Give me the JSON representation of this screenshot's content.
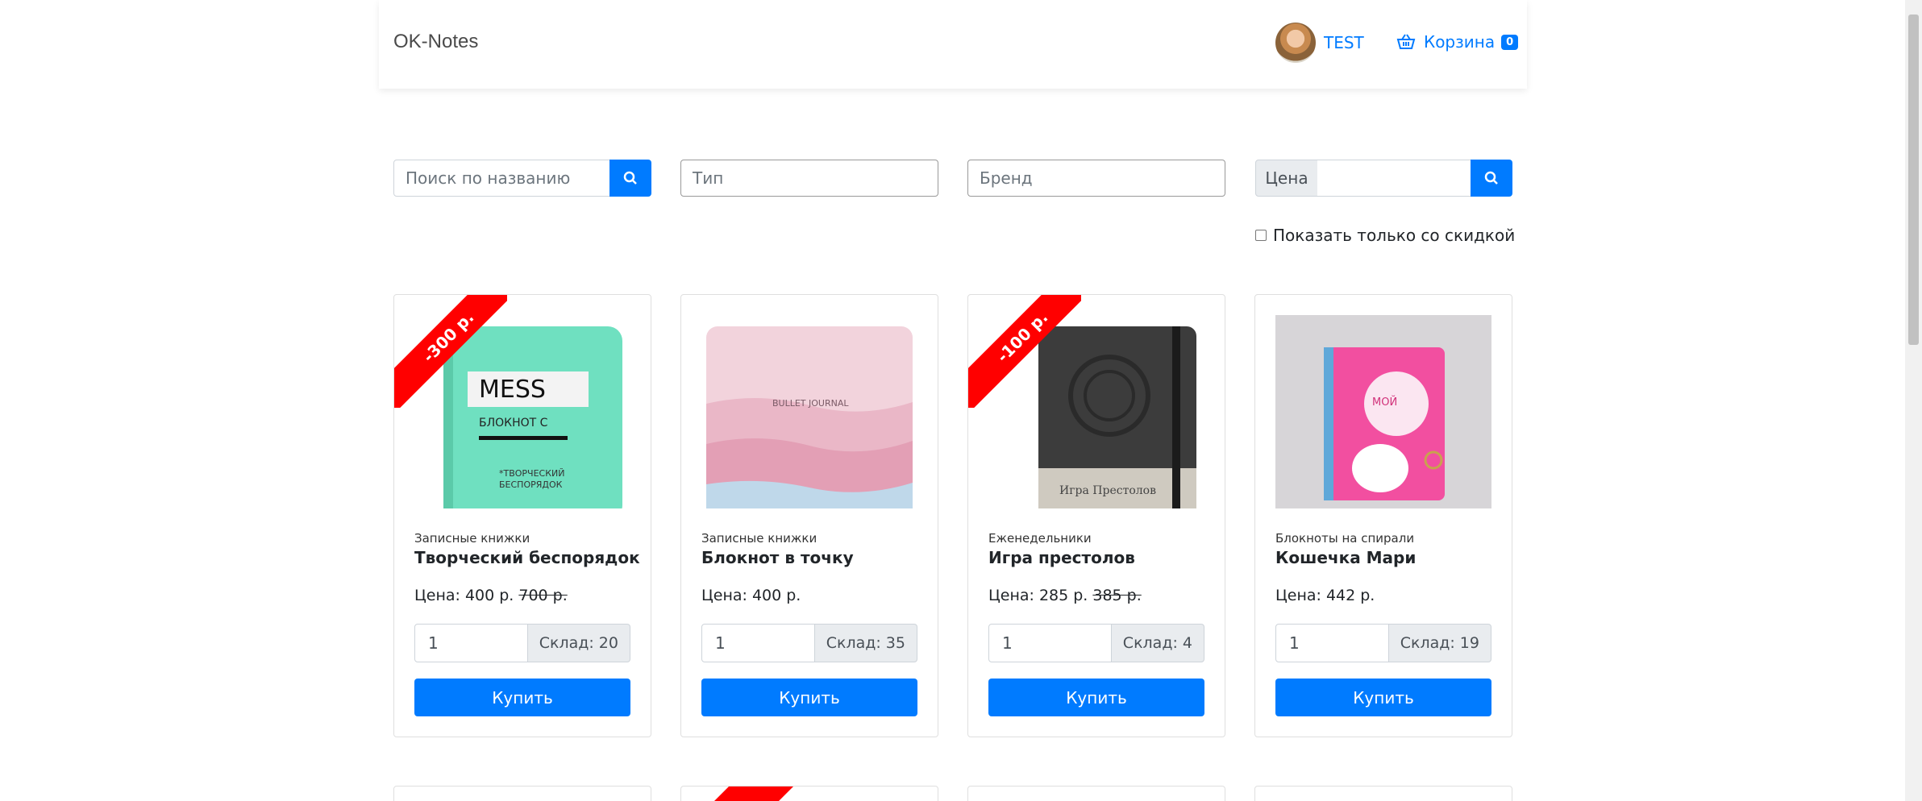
{
  "header": {
    "brand": "OK-Notes",
    "user_name": "TEST",
    "cart_label": "Корзина",
    "cart_count": "0"
  },
  "filters": {
    "search_placeholder": "Поиск по названию",
    "type_placeholder": "Тип",
    "brand_placeholder": "Бренд",
    "price_label": "Цена",
    "discount_label": "Показать только со скидкой",
    "discount_checked": false
  },
  "products": [
    {
      "category": "Записные книжки",
      "title": "Творческий беспорядок",
      "price": "Цена: 400 р.",
      "old_price": "700 р.",
      "discount": "-300 р.",
      "qty": "1",
      "stock": "Склад: 20",
      "buy": "Купить",
      "cover_colors": [
        "#6fe0c0",
        "#5bcaa9"
      ]
    },
    {
      "category": "Записные книжки",
      "title": "Блокнот в точку",
      "price": "Цена: 400 р.",
      "old_price": "",
      "discount": "",
      "qty": "1",
      "stock": "Склад: 35",
      "buy": "Купить",
      "cover_colors": [
        "#f2d3dc",
        "#e7a9bd"
      ],
      "cover_text": "BULLET JOURNAL"
    },
    {
      "category": "Еженедельники",
      "title": "Игра престолов",
      "price": "Цена: 285 р.",
      "old_price": "385 р.",
      "discount": "-100 р.",
      "qty": "1",
      "stock": "Склад: 4",
      "buy": "Купить",
      "cover_colors": [
        "#3c3c3c",
        "#222222"
      ]
    },
    {
      "category": "Блокноты на спирали",
      "title": "Кошечка Мари",
      "price": "Цена: 442 р.",
      "old_price": "",
      "discount": "",
      "qty": "1",
      "stock": "Склад: 19",
      "buy": "Купить",
      "cover_colors": [
        "#f24fa0",
        "#e0398c"
      ]
    }
  ],
  "colors": {
    "accent": "#007bff",
    "ribbon": "#ff0000"
  }
}
